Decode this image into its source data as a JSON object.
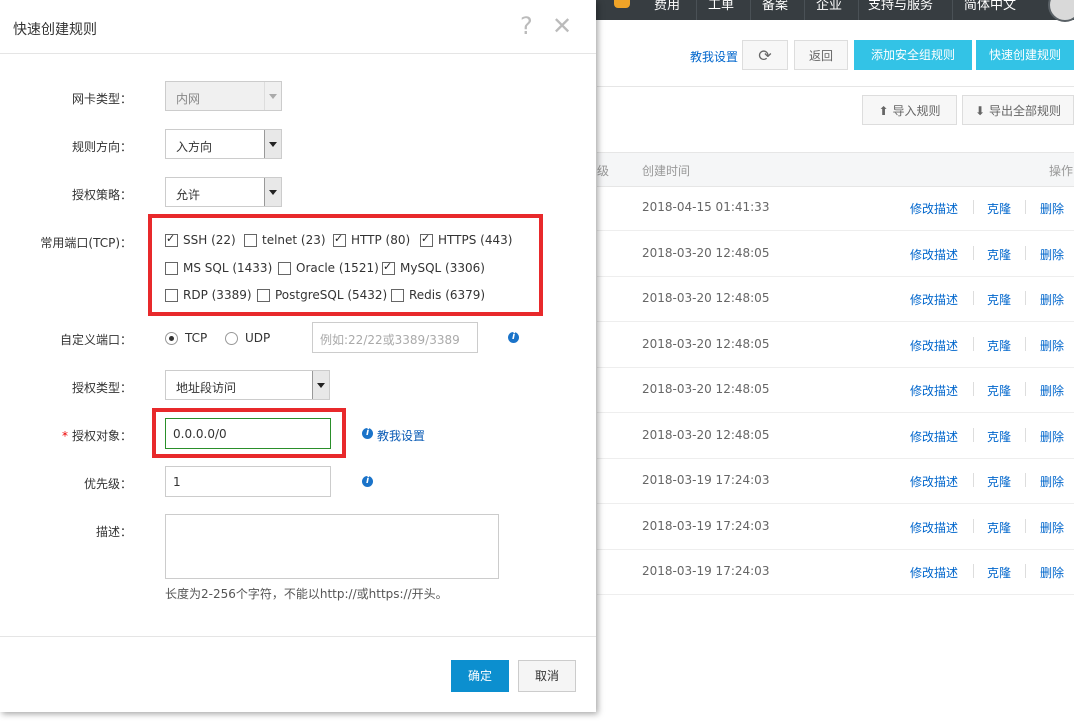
{
  "topnav": {
    "items": [
      "费用",
      "工单",
      "备案",
      "企业",
      "支持与服务",
      "简体中文"
    ]
  },
  "toolbar": {
    "help_link": "教我设置",
    "back": "返回",
    "add_rule": "添加安全组规则",
    "quick_create": "快速创建规则",
    "import": "导入规则",
    "export_all": "导出全部规则"
  },
  "table": {
    "col_partial": "级",
    "col_created": "创建时间",
    "col_ops": "操作",
    "action_labels": [
      "修改描述",
      "克隆",
      "删除"
    ],
    "rows": [
      "2018-04-15 01:41:33",
      "2018-03-20 12:48:05",
      "2018-03-20 12:48:05",
      "2018-03-20 12:48:05",
      "2018-03-20 12:48:05",
      "2018-03-20 12:48:05",
      "2018-03-19 17:24:03",
      "2018-03-19 17:24:03",
      "2018-03-19 17:24:03"
    ]
  },
  "dialog": {
    "title": "快速创建规则",
    "nic_type": {
      "label": "网卡类型：",
      "value": "内网"
    },
    "direction": {
      "label": "规则方向：",
      "value": "入方向"
    },
    "policy": {
      "label": "授权策略：",
      "value": "允许"
    },
    "ports": {
      "label": "常用端口(TCP)：",
      "items": [
        {
          "text": "SSH (22)",
          "checked": true
        },
        {
          "text": "telnet (23)",
          "checked": false
        },
        {
          "text": "HTTP (80)",
          "checked": true
        },
        {
          "text": "HTTPS (443)",
          "checked": true
        },
        {
          "text": "MS SQL (1433)",
          "checked": false
        },
        {
          "text": "Oracle (1521)",
          "checked": false
        },
        {
          "text": "MySQL (3306)",
          "checked": true
        },
        {
          "text": "RDP (3389)",
          "checked": false
        },
        {
          "text": "PostgreSQL (5432)",
          "checked": false
        },
        {
          "text": "Redis (6379)",
          "checked": false
        }
      ]
    },
    "custom_port": {
      "label": "自定义端口：",
      "tcp": "TCP",
      "udp": "UDP",
      "placeholder": "例如:22/22或3389/3389"
    },
    "auth_type": {
      "label": "授权类型：",
      "value": "地址段访问"
    },
    "auth_object": {
      "star": "*",
      "label": "授权对象：",
      "value": "0.0.0.0/0",
      "help": "教我设置"
    },
    "priority": {
      "label": "优先级：",
      "value": "1"
    },
    "description": {
      "label": "描述：",
      "hint": "长度为2-256个字符，不能以http://或https://开头。"
    },
    "ok": "确定",
    "cancel": "取消"
  },
  "colors": {
    "accent": "#0c8fcf",
    "highlight": "#e8292b",
    "link": "#0066cc"
  }
}
